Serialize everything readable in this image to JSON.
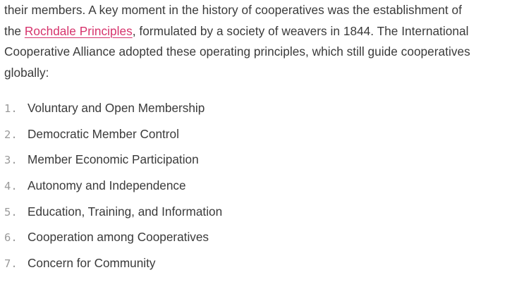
{
  "paragraph": {
    "line1": "their members. A key moment in the history of cooperatives was the establishment of",
    "line2_before_link": "the ",
    "link_text": "Rochdale Principles",
    "line2_after_link": ", formulated by a society of weavers in 1844. The International",
    "line3": "Cooperative Alliance adopted these operating principles, which still guide cooperatives",
    "line4": "globally:"
  },
  "principles": [
    {
      "number": "1.",
      "label": "Voluntary and Open Membership"
    },
    {
      "number": "2.",
      "label": "Democratic Member Control"
    },
    {
      "number": "3.",
      "label": "Member Economic Participation"
    },
    {
      "number": "4.",
      "label": "Autonomy and Independence"
    },
    {
      "number": "5.",
      "label": "Education, Training, and Information"
    },
    {
      "number": "6.",
      "label": "Cooperation among Cooperatives"
    },
    {
      "number": "7.",
      "label": "Concern for Community"
    }
  ],
  "colors": {
    "text": "#3a3a3a",
    "link": "#d6336c",
    "list_number": "#9a9a9a",
    "background": "#ffffff"
  }
}
